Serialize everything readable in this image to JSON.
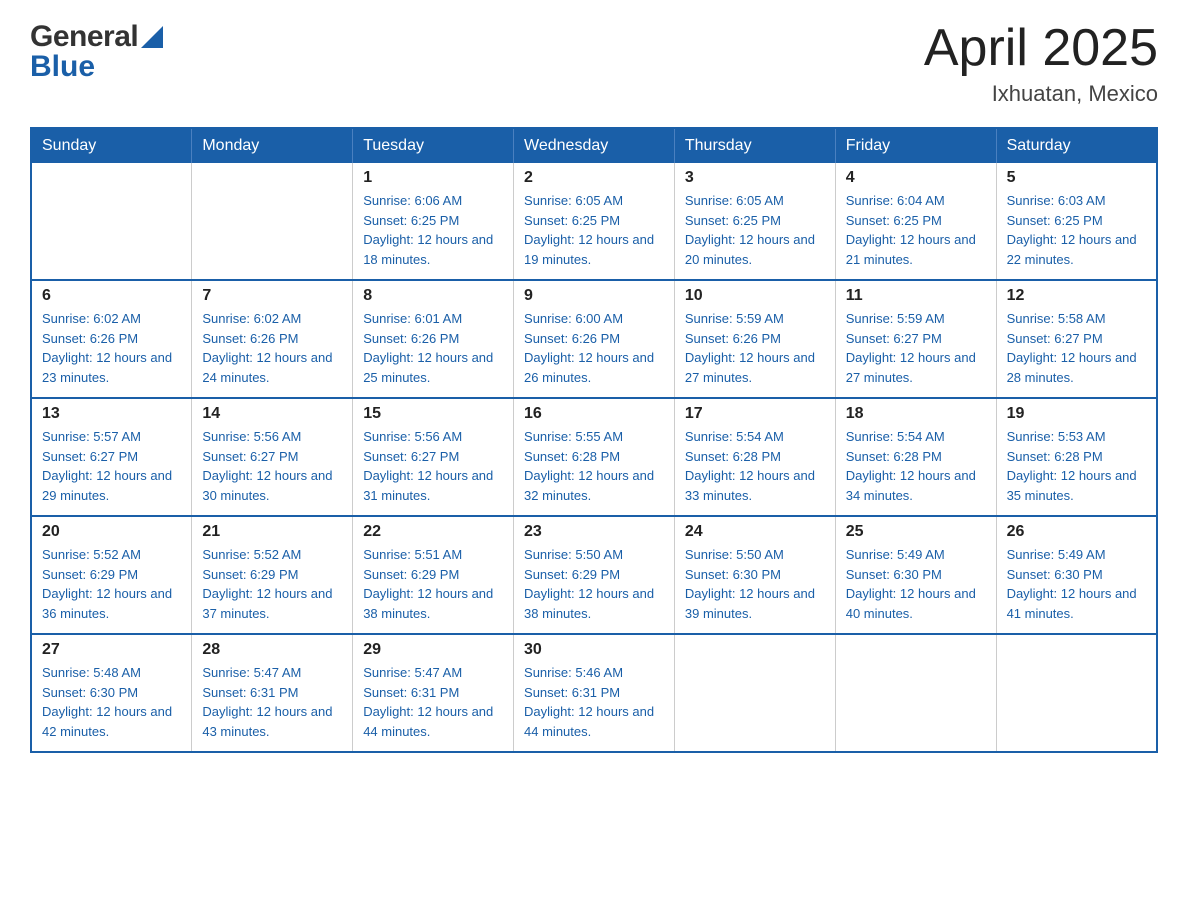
{
  "header": {
    "logo_general": "General",
    "logo_blue": "Blue",
    "title": "April 2025",
    "location": "Ixhuatan, Mexico"
  },
  "weekdays": [
    "Sunday",
    "Monday",
    "Tuesday",
    "Wednesday",
    "Thursday",
    "Friday",
    "Saturday"
  ],
  "weeks": [
    [
      {
        "day": "",
        "sunrise": "",
        "sunset": "",
        "daylight": ""
      },
      {
        "day": "",
        "sunrise": "",
        "sunset": "",
        "daylight": ""
      },
      {
        "day": "1",
        "sunrise": "Sunrise: 6:06 AM",
        "sunset": "Sunset: 6:25 PM",
        "daylight": "Daylight: 12 hours and 18 minutes."
      },
      {
        "day": "2",
        "sunrise": "Sunrise: 6:05 AM",
        "sunset": "Sunset: 6:25 PM",
        "daylight": "Daylight: 12 hours and 19 minutes."
      },
      {
        "day": "3",
        "sunrise": "Sunrise: 6:05 AM",
        "sunset": "Sunset: 6:25 PM",
        "daylight": "Daylight: 12 hours and 20 minutes."
      },
      {
        "day": "4",
        "sunrise": "Sunrise: 6:04 AM",
        "sunset": "Sunset: 6:25 PM",
        "daylight": "Daylight: 12 hours and 21 minutes."
      },
      {
        "day": "5",
        "sunrise": "Sunrise: 6:03 AM",
        "sunset": "Sunset: 6:25 PM",
        "daylight": "Daylight: 12 hours and 22 minutes."
      }
    ],
    [
      {
        "day": "6",
        "sunrise": "Sunrise: 6:02 AM",
        "sunset": "Sunset: 6:26 PM",
        "daylight": "Daylight: 12 hours and 23 minutes."
      },
      {
        "day": "7",
        "sunrise": "Sunrise: 6:02 AM",
        "sunset": "Sunset: 6:26 PM",
        "daylight": "Daylight: 12 hours and 24 minutes."
      },
      {
        "day": "8",
        "sunrise": "Sunrise: 6:01 AM",
        "sunset": "Sunset: 6:26 PM",
        "daylight": "Daylight: 12 hours and 25 minutes."
      },
      {
        "day": "9",
        "sunrise": "Sunrise: 6:00 AM",
        "sunset": "Sunset: 6:26 PM",
        "daylight": "Daylight: 12 hours and 26 minutes."
      },
      {
        "day": "10",
        "sunrise": "Sunrise: 5:59 AM",
        "sunset": "Sunset: 6:26 PM",
        "daylight": "Daylight: 12 hours and 27 minutes."
      },
      {
        "day": "11",
        "sunrise": "Sunrise: 5:59 AM",
        "sunset": "Sunset: 6:27 PM",
        "daylight": "Daylight: 12 hours and 27 minutes."
      },
      {
        "day": "12",
        "sunrise": "Sunrise: 5:58 AM",
        "sunset": "Sunset: 6:27 PM",
        "daylight": "Daylight: 12 hours and 28 minutes."
      }
    ],
    [
      {
        "day": "13",
        "sunrise": "Sunrise: 5:57 AM",
        "sunset": "Sunset: 6:27 PM",
        "daylight": "Daylight: 12 hours and 29 minutes."
      },
      {
        "day": "14",
        "sunrise": "Sunrise: 5:56 AM",
        "sunset": "Sunset: 6:27 PM",
        "daylight": "Daylight: 12 hours and 30 minutes."
      },
      {
        "day": "15",
        "sunrise": "Sunrise: 5:56 AM",
        "sunset": "Sunset: 6:27 PM",
        "daylight": "Daylight: 12 hours and 31 minutes."
      },
      {
        "day": "16",
        "sunrise": "Sunrise: 5:55 AM",
        "sunset": "Sunset: 6:28 PM",
        "daylight": "Daylight: 12 hours and 32 minutes."
      },
      {
        "day": "17",
        "sunrise": "Sunrise: 5:54 AM",
        "sunset": "Sunset: 6:28 PM",
        "daylight": "Daylight: 12 hours and 33 minutes."
      },
      {
        "day": "18",
        "sunrise": "Sunrise: 5:54 AM",
        "sunset": "Sunset: 6:28 PM",
        "daylight": "Daylight: 12 hours and 34 minutes."
      },
      {
        "day": "19",
        "sunrise": "Sunrise: 5:53 AM",
        "sunset": "Sunset: 6:28 PM",
        "daylight": "Daylight: 12 hours and 35 minutes."
      }
    ],
    [
      {
        "day": "20",
        "sunrise": "Sunrise: 5:52 AM",
        "sunset": "Sunset: 6:29 PM",
        "daylight": "Daylight: 12 hours and 36 minutes."
      },
      {
        "day": "21",
        "sunrise": "Sunrise: 5:52 AM",
        "sunset": "Sunset: 6:29 PM",
        "daylight": "Daylight: 12 hours and 37 minutes."
      },
      {
        "day": "22",
        "sunrise": "Sunrise: 5:51 AM",
        "sunset": "Sunset: 6:29 PM",
        "daylight": "Daylight: 12 hours and 38 minutes."
      },
      {
        "day": "23",
        "sunrise": "Sunrise: 5:50 AM",
        "sunset": "Sunset: 6:29 PM",
        "daylight": "Daylight: 12 hours and 38 minutes."
      },
      {
        "day": "24",
        "sunrise": "Sunrise: 5:50 AM",
        "sunset": "Sunset: 6:30 PM",
        "daylight": "Daylight: 12 hours and 39 minutes."
      },
      {
        "day": "25",
        "sunrise": "Sunrise: 5:49 AM",
        "sunset": "Sunset: 6:30 PM",
        "daylight": "Daylight: 12 hours and 40 minutes."
      },
      {
        "day": "26",
        "sunrise": "Sunrise: 5:49 AM",
        "sunset": "Sunset: 6:30 PM",
        "daylight": "Daylight: 12 hours and 41 minutes."
      }
    ],
    [
      {
        "day": "27",
        "sunrise": "Sunrise: 5:48 AM",
        "sunset": "Sunset: 6:30 PM",
        "daylight": "Daylight: 12 hours and 42 minutes."
      },
      {
        "day": "28",
        "sunrise": "Sunrise: 5:47 AM",
        "sunset": "Sunset: 6:31 PM",
        "daylight": "Daylight: 12 hours and 43 minutes."
      },
      {
        "day": "29",
        "sunrise": "Sunrise: 5:47 AM",
        "sunset": "Sunset: 6:31 PM",
        "daylight": "Daylight: 12 hours and 44 minutes."
      },
      {
        "day": "30",
        "sunrise": "Sunrise: 5:46 AM",
        "sunset": "Sunset: 6:31 PM",
        "daylight": "Daylight: 12 hours and 44 minutes."
      },
      {
        "day": "",
        "sunrise": "",
        "sunset": "",
        "daylight": ""
      },
      {
        "day": "",
        "sunrise": "",
        "sunset": "",
        "daylight": ""
      },
      {
        "day": "",
        "sunrise": "",
        "sunset": "",
        "daylight": ""
      }
    ]
  ]
}
